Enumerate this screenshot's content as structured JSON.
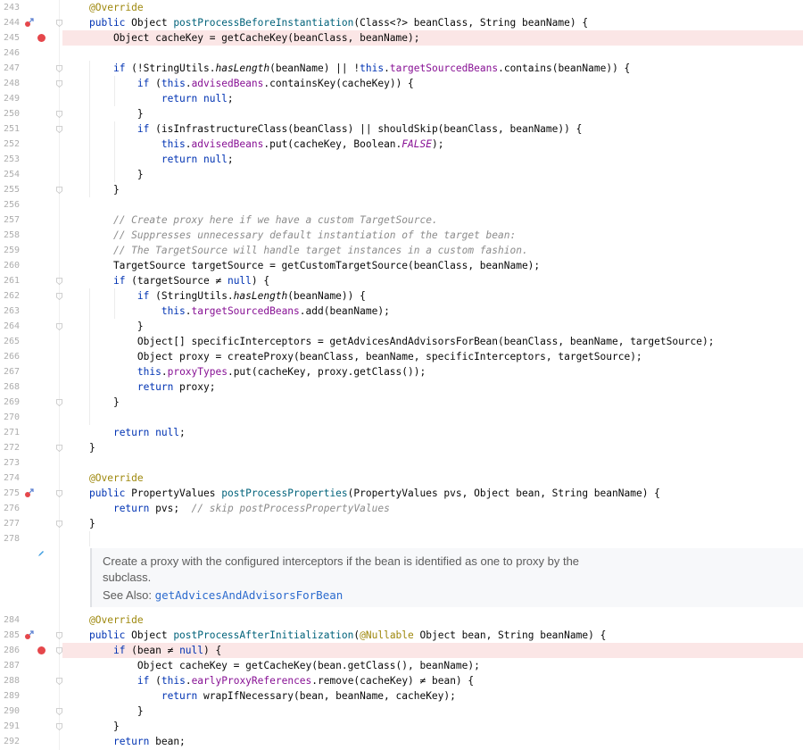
{
  "editor": {
    "lines": [
      {
        "num": "243",
        "tokens": [
          {
            "t": "@Override",
            "c": "ann"
          }
        ]
      },
      {
        "num": "244",
        "tokens": [
          {
            "t": "public ",
            "c": "kw"
          },
          {
            "t": "Object "
          },
          {
            "t": "postProcessBeforeInstantiation",
            "c": "fn"
          },
          {
            "t": "(Class<?> beanClass, String beanName) {"
          }
        ]
      },
      {
        "num": "245",
        "tokens": [
          {
            "t": "    Object cacheKey = getCacheKey(beanClass, beanName);"
          }
        ]
      },
      {
        "num": "246",
        "tokens": []
      },
      {
        "num": "247",
        "tokens": [
          {
            "t": "    "
          },
          {
            "t": "if ",
            "c": "kw"
          },
          {
            "t": "(!StringUtils."
          },
          {
            "t": "hasLength",
            "c": "it"
          },
          {
            "t": "(beanName) || !"
          },
          {
            "t": "this",
            "c": "kw"
          },
          {
            "t": "."
          },
          {
            "t": "targetSourcedBeans",
            "c": "fld"
          },
          {
            "t": ".contains(beanName)) {"
          }
        ]
      },
      {
        "num": "248",
        "tokens": [
          {
            "t": "        "
          },
          {
            "t": "if ",
            "c": "kw"
          },
          {
            "t": "("
          },
          {
            "t": "this",
            "c": "kw"
          },
          {
            "t": "."
          },
          {
            "t": "advisedBeans",
            "c": "fld"
          },
          {
            "t": ".containsKey(cacheKey)) {"
          }
        ]
      },
      {
        "num": "249",
        "tokens": [
          {
            "t": "            "
          },
          {
            "t": "return null",
            "c": "kw"
          },
          {
            "t": ";"
          }
        ]
      },
      {
        "num": "250",
        "tokens": [
          {
            "t": "        }"
          }
        ]
      },
      {
        "num": "251",
        "tokens": [
          {
            "t": "        "
          },
          {
            "t": "if ",
            "c": "kw"
          },
          {
            "t": "(isInfrastructureClass(beanClass) || shouldSkip(beanClass, beanName)) {"
          }
        ]
      },
      {
        "num": "252",
        "tokens": [
          {
            "t": "            "
          },
          {
            "t": "this",
            "c": "kw"
          },
          {
            "t": "."
          },
          {
            "t": "advisedBeans",
            "c": "fld"
          },
          {
            "t": ".put(cacheKey, Boolean."
          },
          {
            "t": "FALSE",
            "c": "fldi"
          },
          {
            "t": ");"
          }
        ]
      },
      {
        "num": "253",
        "tokens": [
          {
            "t": "            "
          },
          {
            "t": "return null",
            "c": "kw"
          },
          {
            "t": ";"
          }
        ]
      },
      {
        "num": "254",
        "tokens": [
          {
            "t": "        }"
          }
        ]
      },
      {
        "num": "255",
        "tokens": [
          {
            "t": "    }"
          }
        ]
      },
      {
        "num": "256",
        "tokens": []
      },
      {
        "num": "257",
        "tokens": [
          {
            "t": "    "
          },
          {
            "t": "// Create proxy here if we have a custom TargetSource.",
            "c": "cmt"
          }
        ]
      },
      {
        "num": "258",
        "tokens": [
          {
            "t": "    "
          },
          {
            "t": "// Suppresses unnecessary default instantiation of the target bean:",
            "c": "cmt"
          }
        ]
      },
      {
        "num": "259",
        "tokens": [
          {
            "t": "    "
          },
          {
            "t": "// The TargetSource will handle target instances in a custom fashion.",
            "c": "cmt"
          }
        ]
      },
      {
        "num": "260",
        "tokens": [
          {
            "t": "    TargetSource targetSource = getCustomTargetSource(beanClass, beanName);"
          }
        ]
      },
      {
        "num": "261",
        "tokens": [
          {
            "t": "    "
          },
          {
            "t": "if ",
            "c": "kw"
          },
          {
            "t": "(targetSource ≠ "
          },
          {
            "t": "null",
            "c": "kw"
          },
          {
            "t": ") {"
          }
        ]
      },
      {
        "num": "262",
        "tokens": [
          {
            "t": "        "
          },
          {
            "t": "if ",
            "c": "kw"
          },
          {
            "t": "(StringUtils."
          },
          {
            "t": "hasLength",
            "c": "it"
          },
          {
            "t": "(beanName)) {"
          }
        ]
      },
      {
        "num": "263",
        "tokens": [
          {
            "t": "            "
          },
          {
            "t": "this",
            "c": "kw"
          },
          {
            "t": "."
          },
          {
            "t": "targetSourcedBeans",
            "c": "fld"
          },
          {
            "t": ".add(beanName);"
          }
        ]
      },
      {
        "num": "264",
        "tokens": [
          {
            "t": "        }"
          }
        ]
      },
      {
        "num": "265",
        "tokens": [
          {
            "t": "        Object[] specificInterceptors = getAdvicesAndAdvisorsForBean(beanClass, beanName, targetSource);"
          }
        ]
      },
      {
        "num": "266",
        "tokens": [
          {
            "t": "        Object proxy = createProxy(beanClass, beanName, specificInterceptors, targetSource);"
          }
        ]
      },
      {
        "num": "267",
        "tokens": [
          {
            "t": "        "
          },
          {
            "t": "this",
            "c": "kw"
          },
          {
            "t": "."
          },
          {
            "t": "proxyTypes",
            "c": "fld"
          },
          {
            "t": ".put(cacheKey, proxy.getClass());"
          }
        ]
      },
      {
        "num": "268",
        "tokens": [
          {
            "t": "        "
          },
          {
            "t": "return ",
            "c": "kw"
          },
          {
            "t": "proxy;"
          }
        ]
      },
      {
        "num": "269",
        "tokens": [
          {
            "t": "    }"
          }
        ]
      },
      {
        "num": "270",
        "tokens": []
      },
      {
        "num": "271",
        "tokens": [
          {
            "t": "    "
          },
          {
            "t": "return null",
            "c": "kw"
          },
          {
            "t": ";"
          }
        ]
      },
      {
        "num": "272",
        "tokens": [
          {
            "t": "}"
          }
        ]
      },
      {
        "num": "273",
        "tokens": []
      },
      {
        "num": "274",
        "tokens": [
          {
            "t": "@Override",
            "c": "ann"
          }
        ]
      },
      {
        "num": "275",
        "tokens": [
          {
            "t": "public ",
            "c": "kw"
          },
          {
            "t": "PropertyValues "
          },
          {
            "t": "postProcessProperties",
            "c": "fn"
          },
          {
            "t": "(PropertyValues pvs, Object bean, String beanName) {"
          }
        ]
      },
      {
        "num": "276",
        "tokens": [
          {
            "t": "    "
          },
          {
            "t": "return ",
            "c": "kw"
          },
          {
            "t": "pvs;  "
          },
          {
            "t": "// skip postProcessPropertyValues",
            "c": "cmt"
          }
        ]
      },
      {
        "num": "277",
        "tokens": [
          {
            "t": "}"
          }
        ]
      },
      {
        "num": "278",
        "tokens": []
      }
    ],
    "lines2": [
      {
        "num": "284",
        "tokens": [
          {
            "t": "@Override",
            "c": "ann"
          }
        ]
      },
      {
        "num": "285",
        "tokens": [
          {
            "t": "public ",
            "c": "kw"
          },
          {
            "t": "Object "
          },
          {
            "t": "postProcessAfterInitialization",
            "c": "fn"
          },
          {
            "t": "("
          },
          {
            "t": "@Nullable",
            "c": "ann"
          },
          {
            "t": " Object bean, String beanName) {"
          }
        ]
      },
      {
        "num": "286",
        "tokens": [
          {
            "t": "    "
          },
          {
            "t": "if ",
            "c": "kw"
          },
          {
            "t": "(bean ≠ "
          },
          {
            "t": "null",
            "c": "kw"
          },
          {
            "t": ") {"
          }
        ]
      },
      {
        "num": "287",
        "tokens": [
          {
            "t": "        Object cacheKey = getCacheKey(bean.getClass(), beanName);"
          }
        ]
      },
      {
        "num": "288",
        "tokens": [
          {
            "t": "        "
          },
          {
            "t": "if ",
            "c": "kw"
          },
          {
            "t": "("
          },
          {
            "t": "this",
            "c": "kw"
          },
          {
            "t": "."
          },
          {
            "t": "earlyProxyReferences",
            "c": "fld"
          },
          {
            "t": ".remove(cacheKey) ≠ bean) {"
          }
        ]
      },
      {
        "num": "289",
        "tokens": [
          {
            "t": "            "
          },
          {
            "t": "return ",
            "c": "kw"
          },
          {
            "t": "wrapIfNecessary(bean, beanName, cacheKey);"
          }
        ]
      },
      {
        "num": "290",
        "tokens": [
          {
            "t": "        }"
          }
        ]
      },
      {
        "num": "291",
        "tokens": [
          {
            "t": "    }"
          }
        ]
      },
      {
        "num": "292",
        "tokens": [
          {
            "t": "    "
          },
          {
            "t": "return ",
            "c": "kw"
          },
          {
            "t": "bean;"
          }
        ]
      }
    ],
    "breakpoint_lines": [
      "245",
      "286"
    ],
    "override_lines": [
      "244",
      "275",
      "285"
    ],
    "doc": {
      "line1": "Create a proxy with the configured interceptors if the bean is identified as one to proxy by the",
      "line2": "subclass.",
      "see_also_label": "See Also:",
      "see_also_link": "getAdvicesAndAdvisorsForBean"
    },
    "colors": {
      "keyword": "#0033b3",
      "annotation": "#9e880d",
      "field": "#871094",
      "comment": "#8c8c8c",
      "method_decl": "#00627a",
      "breakpoint": "#e5474b",
      "highlight": "#fbe6e6"
    }
  }
}
